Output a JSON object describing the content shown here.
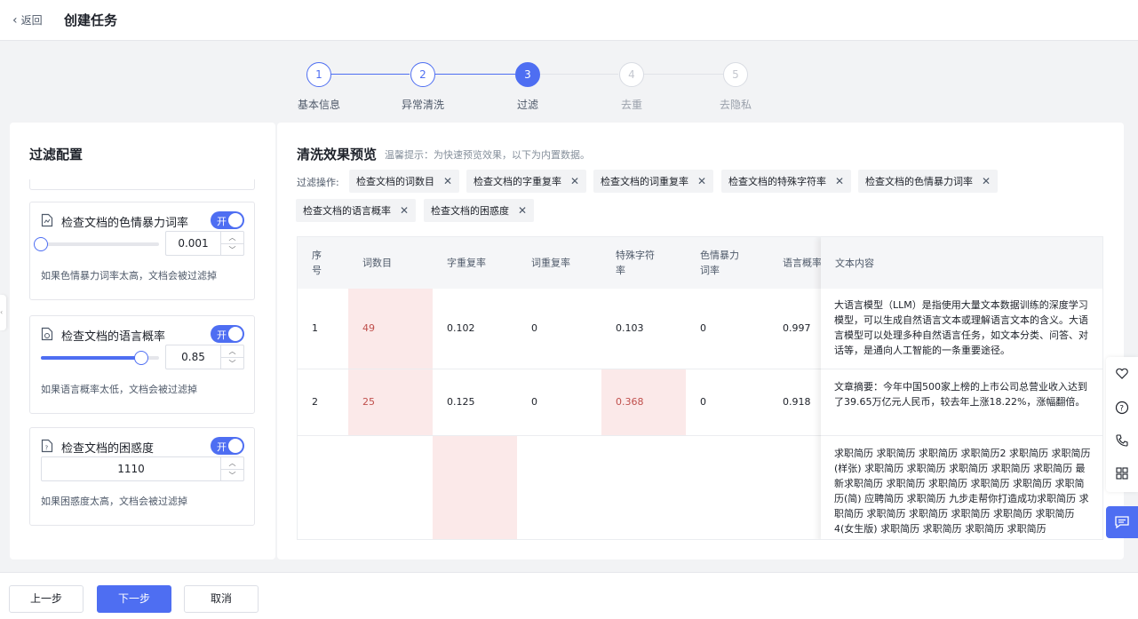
{
  "header": {
    "back_label": "返回",
    "title": "创建任务"
  },
  "steps": [
    {
      "num": "1",
      "label": "基本信息",
      "state": "done"
    },
    {
      "num": "2",
      "label": "异常清洗",
      "state": "done"
    },
    {
      "num": "3",
      "label": "过滤",
      "state": "active"
    },
    {
      "num": "4",
      "label": "去重",
      "state": "todo"
    },
    {
      "num": "5",
      "label": "去隐私",
      "state": "todo"
    }
  ],
  "filter_config": {
    "title": "过滤配置",
    "cards": [
      {
        "title": "检查文档的色情暴力词率",
        "toggle": "开",
        "value": "0.001",
        "slider_level": 0.0,
        "hint": "如果色情暴力词率太高，文档会被过滤掉"
      },
      {
        "title": "检查文档的语言概率",
        "toggle": "开",
        "value": "0.85",
        "slider_level": 0.85,
        "hint": "如果语言概率太低，文档会被过滤掉"
      },
      {
        "title": "检查文档的困惑度",
        "toggle": "开",
        "value": "1110",
        "hint": "如果困惑度太高，文档会被过滤掉"
      }
    ]
  },
  "preview": {
    "title": "清洗效果预览",
    "tip": "温馨提示：为快速预览效果，以下为内置数据。",
    "filter_label": "过滤操作:",
    "chips": [
      "检查文档的词数目",
      "检查文档的字重复率",
      "检查文档的词重复率",
      "检查文档的特殊字符率",
      "检查文档的色情暴力词率",
      "检查文档的语言概率",
      "检查文档的困惑度"
    ],
    "chip_close": "✕",
    "columns": [
      "序号",
      "词数目",
      "字重复率",
      "词重复率",
      "特殊字符率",
      "色情暴力词率",
      "语言概率",
      "文本内容"
    ],
    "rows": [
      {
        "index": "1",
        "words": "49",
        "char_rep": "0.102",
        "word_rep": "0",
        "special": "0.103",
        "porn": "0",
        "lang": "0.997",
        "text": "大语言模型（LLM）是指使用大量文本数据训练的深度学习模型，可以生成自然语言文本或理解语言文本的含义。大语言模型可以处理多种自然语言任务，如文本分类、问答、对话等，是通向人工智能的一条重要途径。"
      },
      {
        "index": "2",
        "words": "25",
        "char_rep": "0.125",
        "word_rep": "0",
        "special": "0.368",
        "porn": "0",
        "lang": "0.918",
        "text": "文章摘要：今年中国500家上榜的上市公司总营业收入达到了39.65万亿元人民币，较去年上涨18.22%，涨幅翻倍。"
      },
      {
        "text": "求职简历 求职简历 求职简历 求职简历2 求职简历 求职简历(样张) 求职简历 求职简历 求职简历 求职简历 求职简历 最新求职简历 求职简历 求职简历 求职简历 求职简历 求职简历(简) 应聘简历 求职简历 九步走帮你打造成功求职简历 求职简历 求职简历 求职简历 求职简历 求职简历 求职简历4(女生版) 求职简历 求职简历 求职简历 求职简历"
      }
    ]
  },
  "footer": {
    "prev": "上一步",
    "next": "下一步",
    "cancel": "取消"
  },
  "colors": {
    "accent": "#4e6ef2",
    "highlight_bg": "#fbe9e9",
    "highlight_text": "#c0504d"
  }
}
